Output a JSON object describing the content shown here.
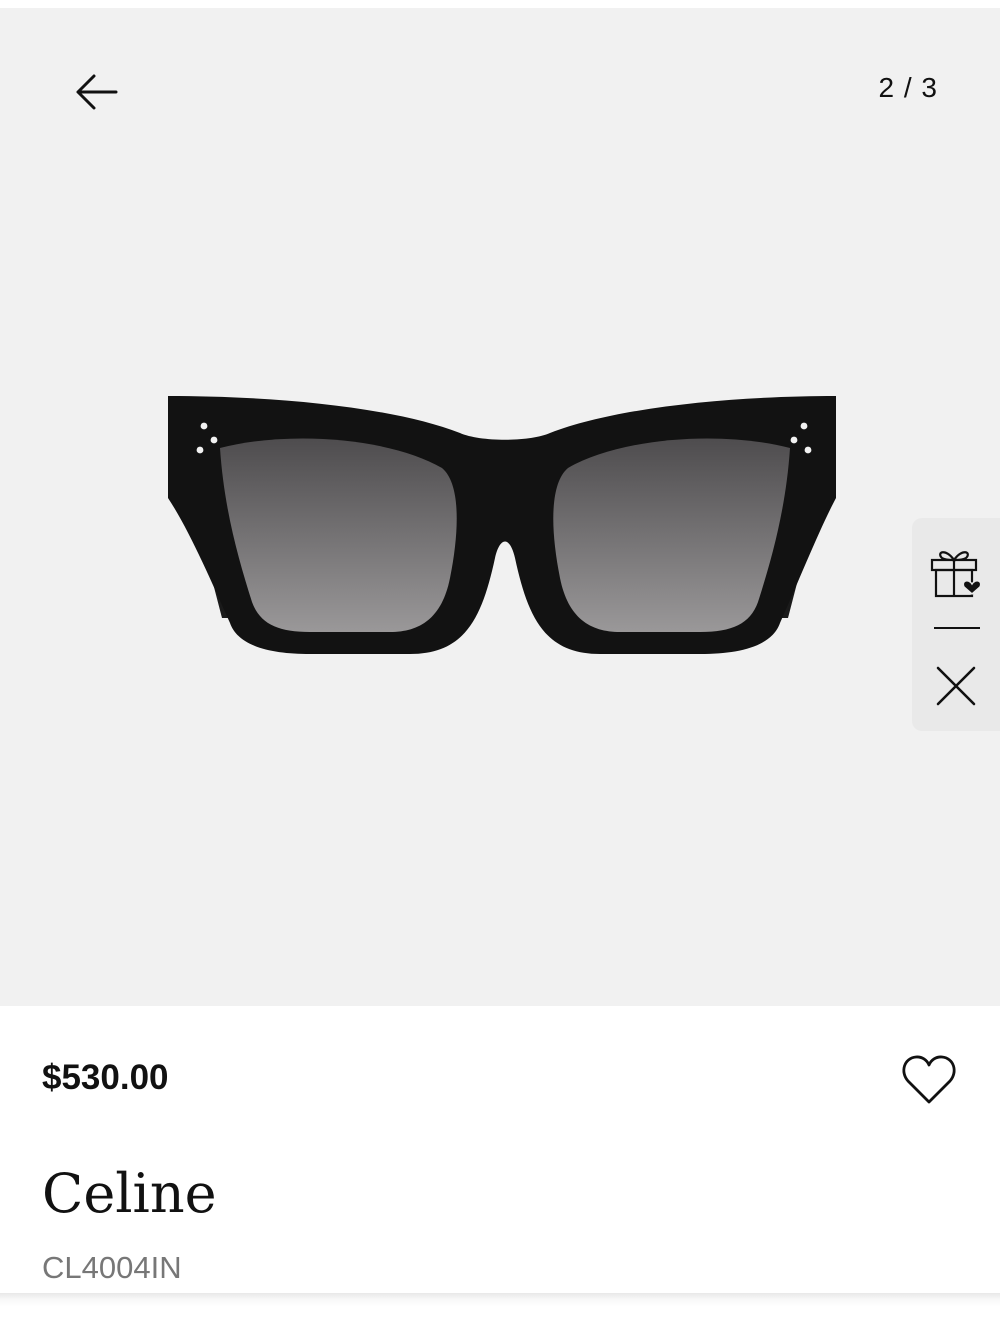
{
  "gallery": {
    "counter": "2 / 3",
    "image_subject": "black cat-eye sunglasses with gradient grey lenses",
    "icons": {
      "back": "arrow-left-icon",
      "gift": "gift-heart-icon",
      "close": "close-icon"
    }
  },
  "product": {
    "price": "$530.00",
    "brand": "Celine",
    "model": "CL4004IN",
    "wishlist_icon": "heart-outline-icon"
  },
  "colors": {
    "gallery_background": "#f1f1f1",
    "text_primary": "#111111",
    "text_secondary": "#777777"
  }
}
